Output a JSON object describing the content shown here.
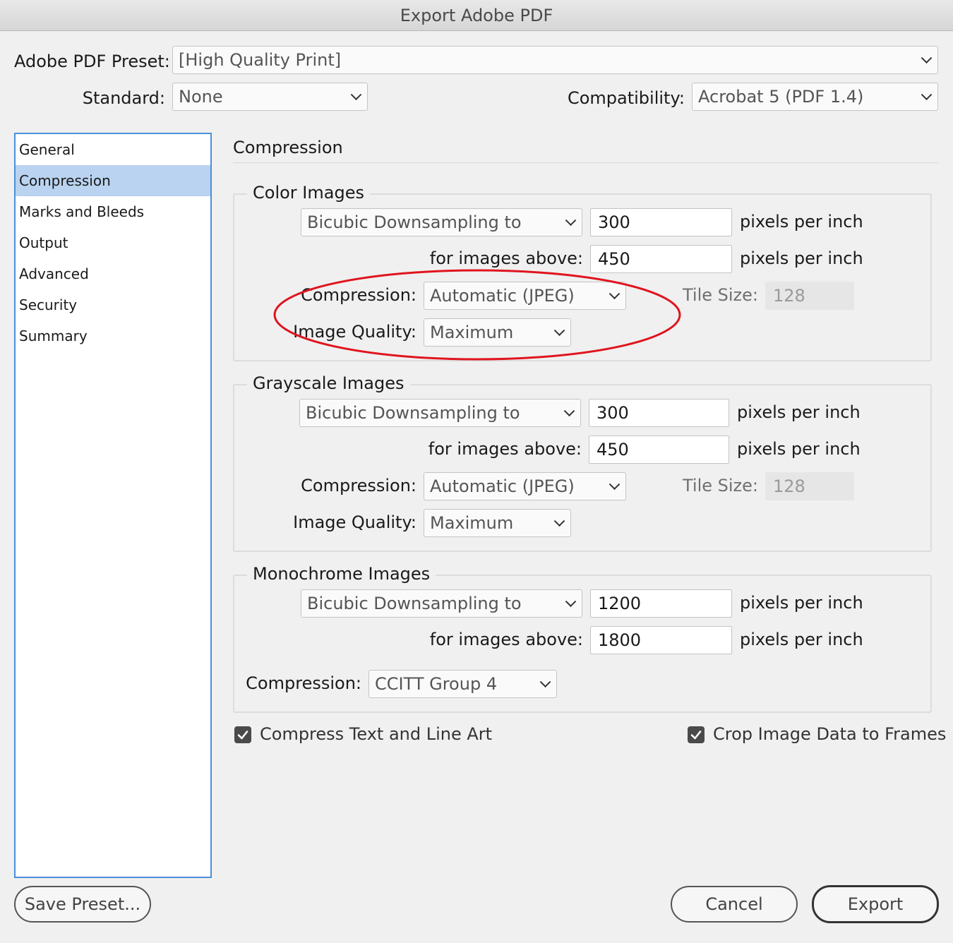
{
  "window": {
    "title": "Export Adobe PDF"
  },
  "header": {
    "preset_label": "Adobe PDF Preset:",
    "preset_value": "[High Quality Print]",
    "standard_label": "Standard:",
    "standard_value": "None",
    "compat_label": "Compatibility:",
    "compat_value": "Acrobat 5 (PDF 1.4)"
  },
  "sidebar": {
    "items": [
      {
        "label": "General"
      },
      {
        "label": "Compression"
      },
      {
        "label": "Marks and Bleeds"
      },
      {
        "label": "Output"
      },
      {
        "label": "Advanced"
      },
      {
        "label": "Security"
      },
      {
        "label": "Summary"
      }
    ],
    "selected": "Compression"
  },
  "main": {
    "title": "Compression",
    "color": {
      "legend": "Color Images",
      "sampling": "Bicubic Downsampling to",
      "ppi": "300",
      "ppi_unit": "pixels per inch",
      "above_label": "for images above:",
      "above": "450",
      "above_unit": "pixels per inch",
      "compression_label": "Compression:",
      "compression": "Automatic (JPEG)",
      "tile_label": "Tile Size:",
      "tile": "128",
      "quality_label": "Image Quality:",
      "quality": "Maximum"
    },
    "gray": {
      "legend": "Grayscale Images",
      "sampling": "Bicubic Downsampling to",
      "ppi": "300",
      "ppi_unit": "pixels per inch",
      "above_label": "for images above:",
      "above": "450",
      "above_unit": "pixels per inch",
      "compression_label": "Compression:",
      "compression": "Automatic (JPEG)",
      "tile_label": "Tile Size:",
      "tile": "128",
      "quality_label": "Image Quality:",
      "quality": "Maximum"
    },
    "mono": {
      "legend": "Monochrome Images",
      "sampling": "Bicubic Downsampling to",
      "ppi": "1200",
      "ppi_unit": "pixels per inch",
      "above_label": "for images above:",
      "above": "1800",
      "above_unit": "pixels per inch",
      "compression_label": "Compression:",
      "compression": "CCITT Group 4"
    },
    "compress_text": {
      "label": "Compress Text and Line Art",
      "checked": true
    },
    "crop_image": {
      "label": "Crop Image Data to Frames",
      "checked": true
    }
  },
  "footer": {
    "save_preset": "Save Preset...",
    "cancel": "Cancel",
    "export": "Export"
  },
  "annotation": {
    "color": "#e0141e"
  },
  "colors": {
    "accent": "#4a90d9",
    "selection": "#b9d3f0"
  }
}
